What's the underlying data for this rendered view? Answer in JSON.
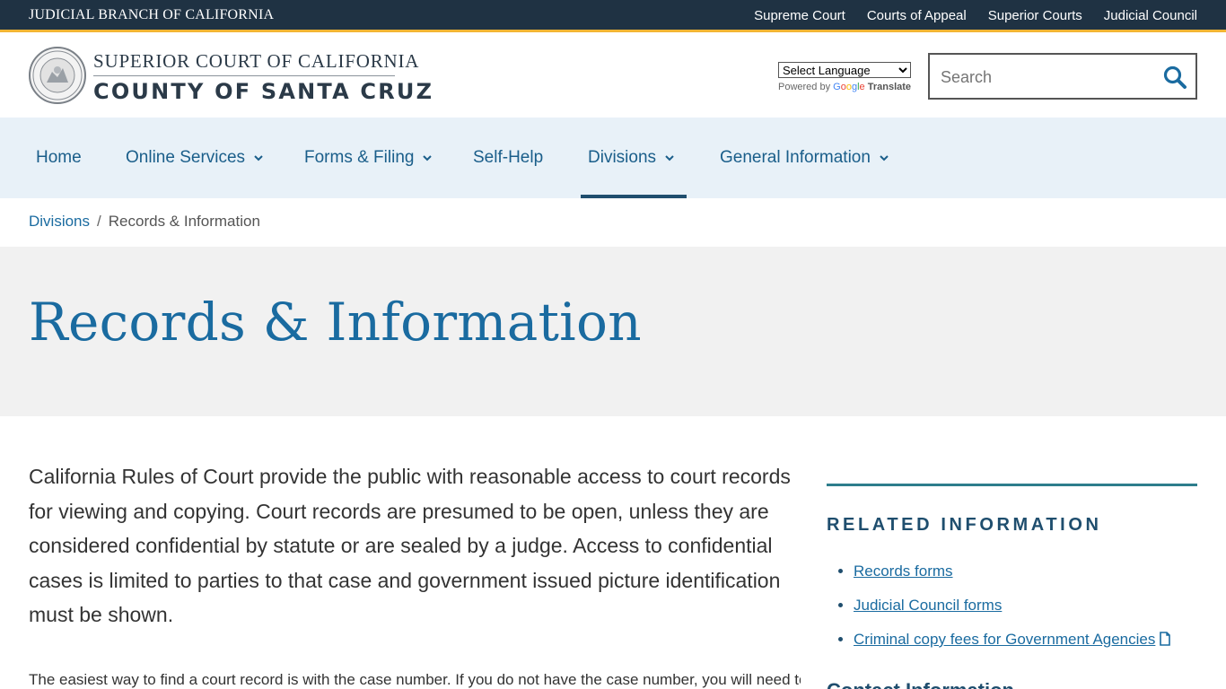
{
  "topbar": {
    "brand": "JUDICIAL BRANCH OF CALIFORNIA",
    "links": [
      "Supreme Court",
      "Courts of Appeal",
      "Superior Courts",
      "Judicial Council"
    ],
    "accent": "#f2b534"
  },
  "header": {
    "line1": "SUPERIOR COURT OF CALIFORNIA",
    "line2": "COUNTY OF SANTA CRUZ",
    "seal_text": "JUDICIAL BRANCH OF CALIFORNIA",
    "translate": {
      "select_label": "Select Language",
      "powered_by": "Powered by",
      "google": "Google",
      "translate": "Translate"
    },
    "search": {
      "placeholder": "Search",
      "icon": "search-icon"
    }
  },
  "nav": {
    "items": [
      {
        "label": "Home",
        "dropdown": false
      },
      {
        "label": "Online Services",
        "dropdown": true
      },
      {
        "label": "Forms & Filing",
        "dropdown": true
      },
      {
        "label": "Self-Help",
        "dropdown": false
      },
      {
        "label": "Divisions",
        "dropdown": true,
        "active": true
      },
      {
        "label": "General Information",
        "dropdown": true
      }
    ]
  },
  "breadcrumb": {
    "parent": "Divisions",
    "separator": "/",
    "current": "Records & Information"
  },
  "page": {
    "title": "Records & Information",
    "intro": "California Rules of Court provide the public with reasonable access to court records for viewing and copying. Court records are presumed to be open, unless they are considered confidential by statute or are sealed by a judge. Access to confidential cases is limited to parties to that case and government issued picture identification must be shown.",
    "para2": "The easiest way to find a court record is with the case number. If you do not have the case number, you will need to"
  },
  "sidebar": {
    "heading": "RELATED INFORMATION",
    "links": [
      {
        "label": "Records forms",
        "doc_icon": false
      },
      {
        "label": "Judicial Council forms",
        "doc_icon": false
      },
      {
        "label": "Criminal copy fees for Government Agencies",
        "doc_icon": true
      }
    ],
    "next_heading": "Contact Information"
  },
  "colors": {
    "topbar": "#1f3243",
    "nav_bg": "#e8f1f8",
    "link": "#1a6ba0",
    "title": "#1a6ba0",
    "sidebar_rule": "#2e7d8c"
  }
}
